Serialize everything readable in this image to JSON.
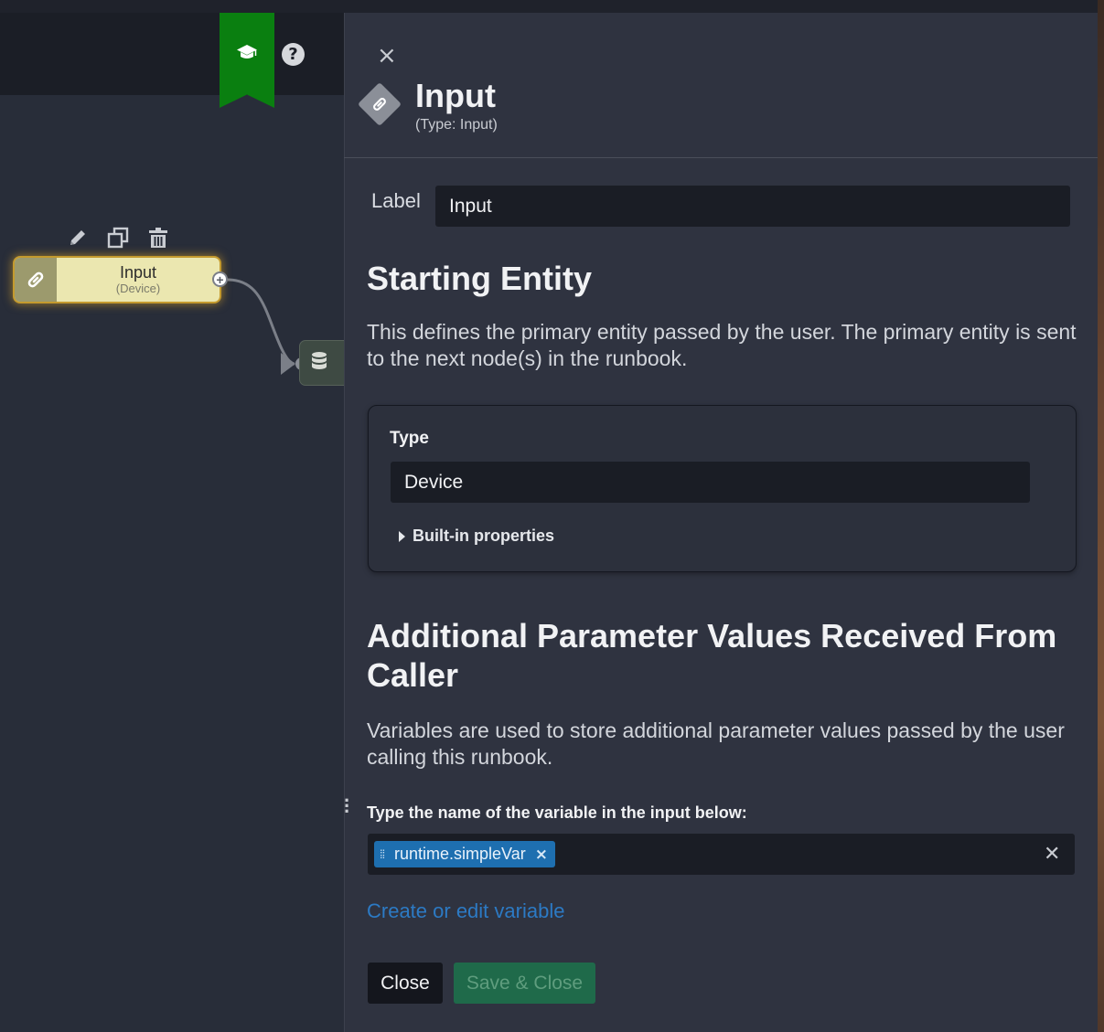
{
  "toolbar": {
    "learn_icon": "graduation-cap-icon",
    "help_icon": "question-icon",
    "help_label": "?"
  },
  "canvas": {
    "node": {
      "title": "Input",
      "subtitle": "(Device)",
      "icon": "link-icon"
    },
    "node_actions": [
      "pencil-icon",
      "copy-icon",
      "trash-icon"
    ],
    "next_node_icon": "database-icon"
  },
  "panel": {
    "close_label": "×",
    "title": "Input",
    "subtitle": "(Type: Input)",
    "label_caption": "Label",
    "label_value": "Input",
    "starting_entity": {
      "heading": "Starting Entity",
      "description": "This defines the primary entity passed by the user. The primary entity is sent to the next node(s) in the runbook.",
      "type_label": "Type",
      "type_value": "Device",
      "builtin_label": "Built-in properties"
    },
    "additional": {
      "heading": "Additional Parameter Values Received From Caller",
      "description": "Variables are used to store additional parameter values passed by the user calling this runbook.",
      "instruction": "Type the name of the variable in the input below:",
      "variables": [
        "runtime.simpleVar"
      ],
      "chip_remove": "×",
      "clear_label": "✕",
      "link_text": "Create or edit variable"
    },
    "buttons": {
      "close": "Close",
      "save": "Save & Close"
    }
  },
  "colors": {
    "accent_green": "#0a7f10",
    "chip_blue": "#1e6fb0",
    "link_blue": "#2c7ac4",
    "save_green": "#1f6a4a",
    "node_fill": "#ebe7b0"
  }
}
